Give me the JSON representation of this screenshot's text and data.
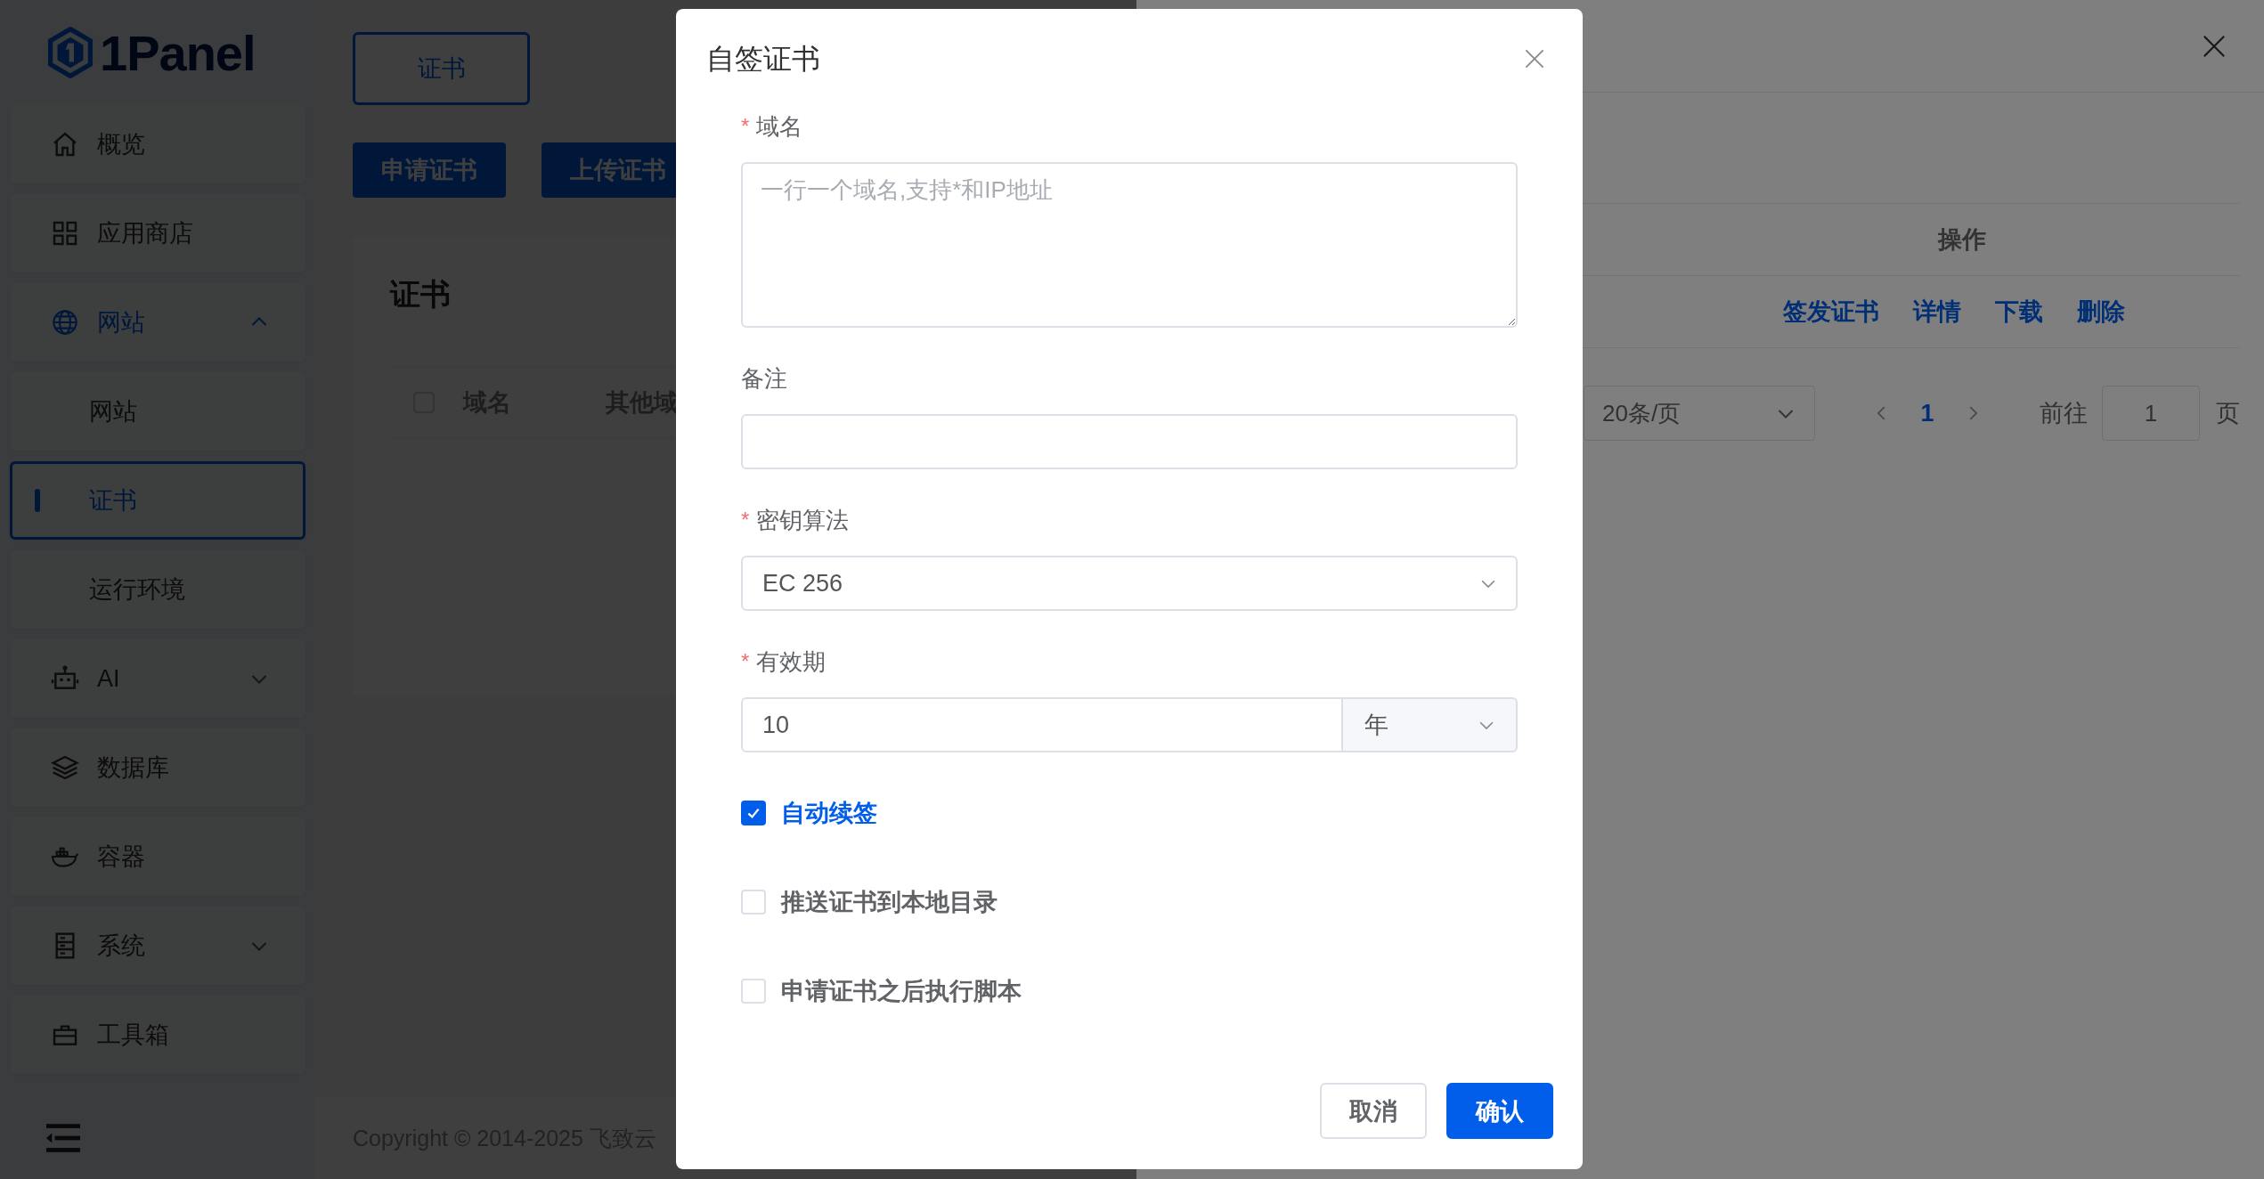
{
  "sidebar": {
    "logo": "1Panel",
    "menu": [
      {
        "label": "概览",
        "selected": false
      },
      {
        "label": "应用商店",
        "selected": false
      },
      {
        "label": "网站",
        "selected": true,
        "expanded": true,
        "children": [
          {
            "label": "网站",
            "selected": false
          },
          {
            "label": "证书",
            "selected": true
          },
          {
            "label": "运行环境",
            "selected": false
          }
        ]
      },
      {
        "label": "AI",
        "selected": false,
        "expanded": false
      },
      {
        "label": "数据库",
        "selected": false
      },
      {
        "label": "容器",
        "selected": false
      },
      {
        "label": "系统",
        "selected": false,
        "expanded": false
      },
      {
        "label": "工具箱",
        "selected": false
      }
    ]
  },
  "main": {
    "tab": "证书",
    "buttons": [
      "申请证书",
      "上传证书"
    ],
    "card": {
      "title": "证书",
      "select_all_checked": false,
      "columns": [
        "域名",
        "其他域"
      ]
    },
    "footer": "Copyright © 2014-2025 飞致云"
  },
  "drawer": {
    "columns": [
      "操作"
    ],
    "row_actions": [
      "签发证书",
      "详情",
      "下载",
      "删除"
    ],
    "pagination": {
      "page_size": "20条/页",
      "pages": [
        {
          "label": "1",
          "selected": true
        }
      ],
      "goto_label": "前往",
      "goto_value": "1",
      "page_suffix": "页"
    }
  },
  "dialog": {
    "title": "自签证书",
    "required_mark": "*",
    "fields": [
      {
        "kind": "textarea",
        "label": "域名",
        "required": true,
        "placeholder": "一行一个域名,支持*和IP地址"
      },
      {
        "kind": "input",
        "label": "备注",
        "required": false
      },
      {
        "kind": "select",
        "label": "密钥算法",
        "required": true,
        "value": "EC 256"
      },
      {
        "kind": "number_unit",
        "label": "有效期",
        "required": true,
        "value": "10",
        "unit": "年"
      }
    ],
    "options": [
      {
        "label": "自动续签",
        "checked": true
      },
      {
        "label": "推送证书到本地目录",
        "checked": false
      },
      {
        "label": "申请证书之后执行脚本",
        "checked": false
      }
    ],
    "buttons": [
      {
        "label": "取消",
        "kind": "default"
      },
      {
        "label": "确认",
        "kind": "primary"
      }
    ]
  }
}
